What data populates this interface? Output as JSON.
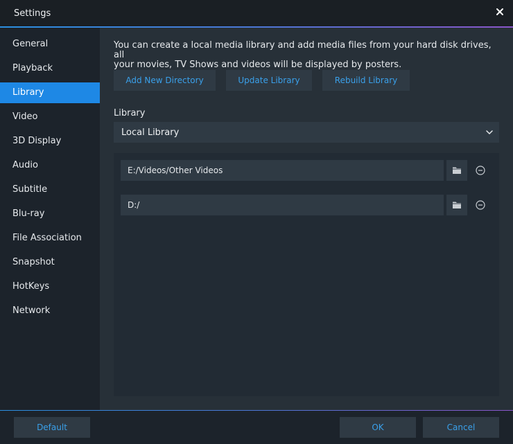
{
  "window": {
    "title": "Settings",
    "close_icon": "close-icon"
  },
  "sidebar": {
    "items": [
      {
        "label": "General",
        "active": false
      },
      {
        "label": "Playback",
        "active": false
      },
      {
        "label": "Library",
        "active": true
      },
      {
        "label": "Video",
        "active": false
      },
      {
        "label": "3D Display",
        "active": false
      },
      {
        "label": "Audio",
        "active": false
      },
      {
        "label": "Subtitle",
        "active": false
      },
      {
        "label": "Blu-ray",
        "active": false
      },
      {
        "label": "File Association",
        "active": false
      },
      {
        "label": "Snapshot",
        "active": false
      },
      {
        "label": "HotKeys",
        "active": false
      },
      {
        "label": "Network",
        "active": false
      }
    ]
  },
  "library": {
    "description_line1": "You can create a local media library and add media files from your hard disk drives, all",
    "description_line2": "your movies, TV Shows and videos will be displayed by posters.",
    "buttons": {
      "add": "Add New Directory",
      "update": "Update Library",
      "rebuild": "Rebuild Library"
    },
    "library_label": "Library",
    "selected_library": "Local Library",
    "directories": [
      {
        "path": "E:/Videos/Other Videos"
      },
      {
        "path": "D:/"
      }
    ]
  },
  "footer": {
    "default_label": "Default",
    "ok_label": "OK",
    "cancel_label": "Cancel"
  },
  "colors": {
    "accent": "#1e88e5",
    "link": "#3aa0ea",
    "background": "#1c232b",
    "panel": "#273038"
  }
}
